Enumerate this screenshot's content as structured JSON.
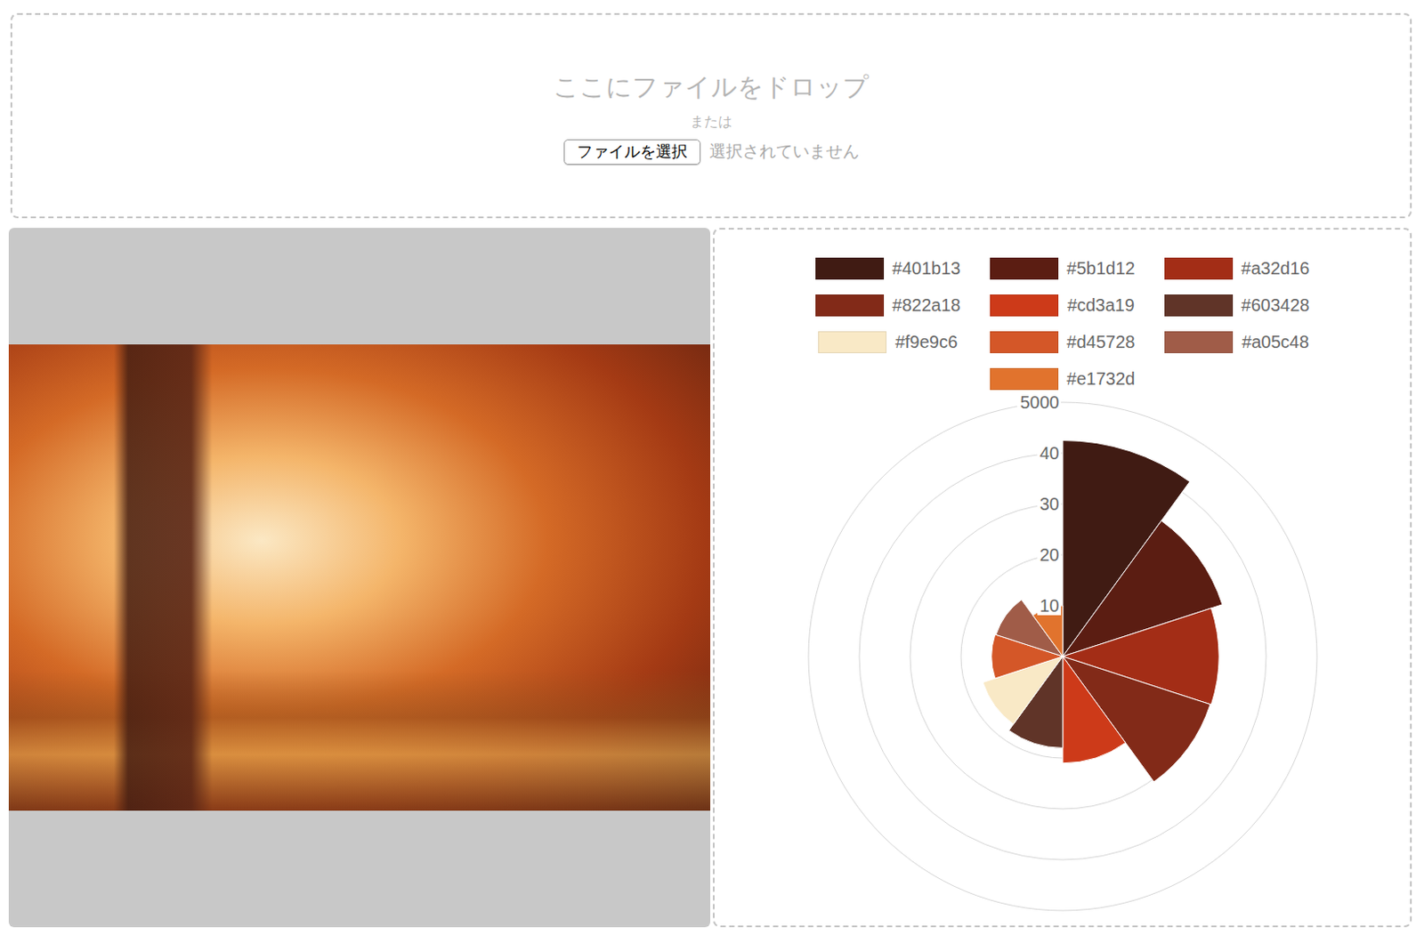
{
  "dropzone": {
    "title": "ここにファイルをドロップ",
    "separator": "または",
    "button": "ファイルを選択",
    "file_status": "選択されていません"
  },
  "chart": {
    "legend": [
      {
        "label": "#401b13",
        "color": "#401b13"
      },
      {
        "label": "#5b1d12",
        "color": "#5b1d12"
      },
      {
        "label": "#a32d16",
        "color": "#a32d16"
      },
      {
        "label": "#822a18",
        "color": "#822a18"
      },
      {
        "label": "#cd3a19",
        "color": "#cd3a19"
      },
      {
        "label": "#603428",
        "color": "#603428"
      },
      {
        "label": "#f9e9c6",
        "color": "#f9e9c6"
      },
      {
        "label": "#d45728",
        "color": "#d45728"
      },
      {
        "label": "#a05c48",
        "color": "#a05c48"
      },
      {
        "label": "#e1732d",
        "color": "#e1732d"
      }
    ],
    "ticks": [
      "5000",
      "40",
      "30",
      "20",
      "10"
    ],
    "values": [
      4250,
      3300,
      3070,
      3050,
      2100,
      1800,
      1650,
      1400,
      1380,
      1000
    ]
  }
}
